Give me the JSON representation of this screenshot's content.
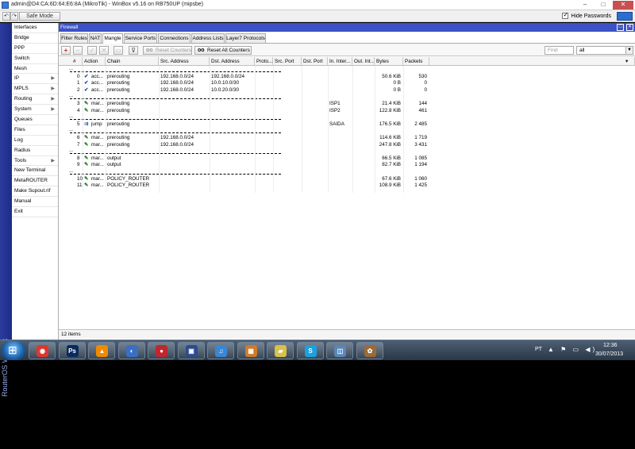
{
  "window": {
    "title": "admin@D4:CA:6D:64:E6:8A (MikroTik) - WinBox v5.16 on RB750UP (mipsbe)",
    "min": "–",
    "max": "□",
    "close": "✕"
  },
  "toolbar": {
    "back": "↶",
    "forward": "↷",
    "safe_mode": "Safe Mode",
    "hide_passwords": "Hide Passwords"
  },
  "strip_text": "RouterOS WinBox",
  "sidebar": {
    "items": [
      {
        "label": "Interfaces",
        "arrow": ""
      },
      {
        "label": "Bridge",
        "arrow": ""
      },
      {
        "label": "PPP",
        "arrow": ""
      },
      {
        "label": "Switch",
        "arrow": ""
      },
      {
        "label": "Mesh",
        "arrow": ""
      },
      {
        "label": "IP",
        "arrow": "▶"
      },
      {
        "label": "MPLS",
        "arrow": "▶"
      },
      {
        "label": "Routing",
        "arrow": "▶"
      },
      {
        "label": "System",
        "arrow": "▶"
      },
      {
        "label": "Queues",
        "arrow": ""
      },
      {
        "label": "Files",
        "arrow": ""
      },
      {
        "label": "Log",
        "arrow": ""
      },
      {
        "label": "Radius",
        "arrow": ""
      },
      {
        "label": "Tools",
        "arrow": "▶"
      },
      {
        "label": "New Terminal",
        "arrow": ""
      },
      {
        "label": "MetaROUTER",
        "arrow": ""
      },
      {
        "label": "Make Supout.rif",
        "arrow": ""
      },
      {
        "label": "Manual",
        "arrow": ""
      },
      {
        "label": "Exit",
        "arrow": ""
      }
    ]
  },
  "firewall": {
    "title": "Firewall",
    "win_max": "□",
    "win_close": "✕",
    "tabs": [
      "Filter Rules",
      "NAT",
      "Mangle",
      "Service Ports",
      "Connections",
      "Address Lists",
      "Layer7 Protocols"
    ],
    "active_tab": "Mangle",
    "buttons": {
      "add": "+",
      "remove": "−",
      "enable": "✓",
      "disable": "✕",
      "comment": "▭",
      "filter": "⊽",
      "reset_counters": "Reset Counters",
      "reset_all_counters": "Reset All Counters",
      "oo": "oo"
    },
    "find_placeholder": "Find",
    "filter_value": "all",
    "filter_arrow": "▼",
    "columns": [
      "#",
      "Action",
      "Chain",
      "Src. Address",
      "Dst. Address",
      "Proto...",
      "Src. Port",
      "Dst. Port",
      "In. Inter...",
      "Out. Int...",
      "Bytes",
      "Packets"
    ],
    "rows": [
      {
        "type": "sep"
      },
      {
        "type": "rule",
        "num": "0",
        "action": "acc...",
        "icon": "accept",
        "chain": "prerouting",
        "src": "192.168.0.0/24",
        "dst": "192.168.0.0/24",
        "in": "",
        "bytes": "50.6 KiB",
        "packets": "530"
      },
      {
        "type": "rule",
        "num": "1",
        "action": "acc...",
        "icon": "accept",
        "chain": "prerouting",
        "src": "192.168.0.0/24",
        "dst": "10.0.10.0/30",
        "in": "",
        "bytes": "0 B",
        "packets": "0"
      },
      {
        "type": "rule",
        "num": "2",
        "action": "acc...",
        "icon": "accept",
        "chain": "prerouting",
        "src": "192.168.0.0/24",
        "dst": "10.0.20.0/30",
        "in": "",
        "bytes": "0 B",
        "packets": "0"
      },
      {
        "type": "sep"
      },
      {
        "type": "rule",
        "num": "3",
        "action": "mar...",
        "icon": "mark",
        "chain": "prerouting",
        "src": "",
        "dst": "",
        "in": "ISP1",
        "bytes": "21.4 KiB",
        "packets": "144"
      },
      {
        "type": "rule",
        "num": "4",
        "action": "mar...",
        "icon": "mark",
        "chain": "prerouting",
        "src": "",
        "dst": "",
        "in": "ISP2",
        "bytes": "122.8 KiB",
        "packets": "461"
      },
      {
        "type": "sep"
      },
      {
        "type": "rule",
        "num": "5",
        "action": "jump",
        "icon": "jump",
        "chain": "prerouting",
        "src": "",
        "dst": "",
        "in": "SAIDA",
        "bytes": "176.5 KiB",
        "packets": "2 485"
      },
      {
        "type": "sep"
      },
      {
        "type": "rule",
        "num": "6",
        "action": "mar...",
        "icon": "mark",
        "chain": "prerouting",
        "src": "192.168.0.0/24",
        "dst": "",
        "in": "",
        "bytes": "114.6 KiB",
        "packets": "1 719"
      },
      {
        "type": "rule",
        "num": "7",
        "action": "mar...",
        "icon": "mark",
        "chain": "prerouting",
        "src": "192.168.0.0/24",
        "dst": "",
        "in": "",
        "bytes": "247.8 KiB",
        "packets": "3 431"
      },
      {
        "type": "sep"
      },
      {
        "type": "rule",
        "num": "8",
        "action": "mar...",
        "icon": "mark",
        "chain": "output",
        "src": "",
        "dst": "",
        "in": "",
        "bytes": "66.5 KiB",
        "packets": "1 085"
      },
      {
        "type": "rule",
        "num": "9",
        "action": "mar...",
        "icon": "mark",
        "chain": "output",
        "src": "",
        "dst": "",
        "in": "",
        "bytes": "82.7 KiB",
        "packets": "1 194"
      },
      {
        "type": "sep"
      },
      {
        "type": "rule",
        "num": "10",
        "action": "mar...",
        "icon": "mark",
        "chain": "POLICY_ROUTER",
        "src": "",
        "dst": "",
        "in": "",
        "bytes": "67.6 KiB",
        "packets": "1 060"
      },
      {
        "type": "rule",
        "num": "11",
        "action": "mar...",
        "icon": "mark",
        "chain": "POLICY_ROUTER",
        "src": "",
        "dst": "",
        "in": "",
        "bytes": "108.9 KiB",
        "packets": "1 425"
      }
    ],
    "status": "12 items"
  },
  "icons": {
    "accept": "✔",
    "mark": "✎",
    "jump": "⇉"
  },
  "colors": {
    "sidebar_strip": "#2b3a9e",
    "window_title": "#3c52c6"
  },
  "taskbar": {
    "apps": [
      {
        "name": "chrome-icon",
        "glyph": "◉",
        "color": "#d9382f"
      },
      {
        "name": "photoshop-icon",
        "glyph": "Ps",
        "color": "#0a2a5c"
      },
      {
        "name": "vlc-icon",
        "glyph": "▲",
        "color": "#f08a00"
      },
      {
        "name": "app-icon",
        "glyph": "◐",
        "color": "#3a6fc4"
      },
      {
        "name": "record-icon",
        "glyph": "●",
        "color": "#c0262d"
      },
      {
        "name": "winbox-icon",
        "glyph": "▣",
        "color": "#2c4c90"
      },
      {
        "name": "itunes-icon",
        "glyph": "♫",
        "color": "#3a86d4"
      },
      {
        "name": "media-icon",
        "glyph": "▦",
        "color": "#d07a2a"
      },
      {
        "name": "folder-icon",
        "glyph": "▰",
        "color": "#d8c04a"
      },
      {
        "name": "skype-icon",
        "glyph": "S",
        "color": "#1aa1e0"
      },
      {
        "name": "network-icon",
        "glyph": "◫",
        "color": "#5a86b8"
      },
      {
        "name": "gimp-icon",
        "glyph": "✿",
        "color": "#9a6a3a"
      }
    ],
    "lang": "PT",
    "tray": "▲ ⚑ ▭ ◀)",
    "time": "12:36",
    "date": "30/07/2013"
  }
}
